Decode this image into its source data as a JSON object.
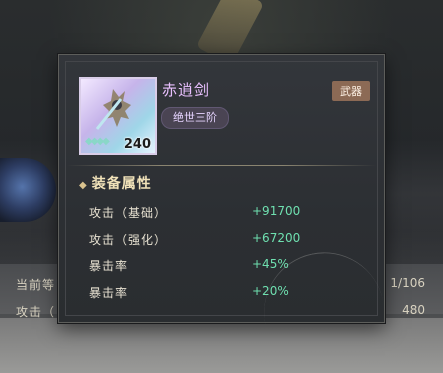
{
  "background": {
    "row1_label": "当前等",
    "row1_value": "1/106",
    "row2_label": "攻击（",
    "row2_value": "480"
  },
  "item": {
    "name": "赤逍剑",
    "tier": "绝世三阶",
    "type": "武器",
    "level": "240",
    "icon": "sword-emblem-icon"
  },
  "attributes": {
    "title": "装备属性",
    "stats": [
      {
        "label": "攻击（基础）",
        "value": "+91700"
      },
      {
        "label": "攻击（强化）",
        "value": "+67200"
      },
      {
        "label": "暴击率",
        "value": "+45%"
      },
      {
        "label": "暴击率",
        "value": "+20%"
      }
    ]
  },
  "colors": {
    "name": "#e9c0ff",
    "stat_value": "#6fe0b0",
    "type_badge": "#8c6a55"
  }
}
